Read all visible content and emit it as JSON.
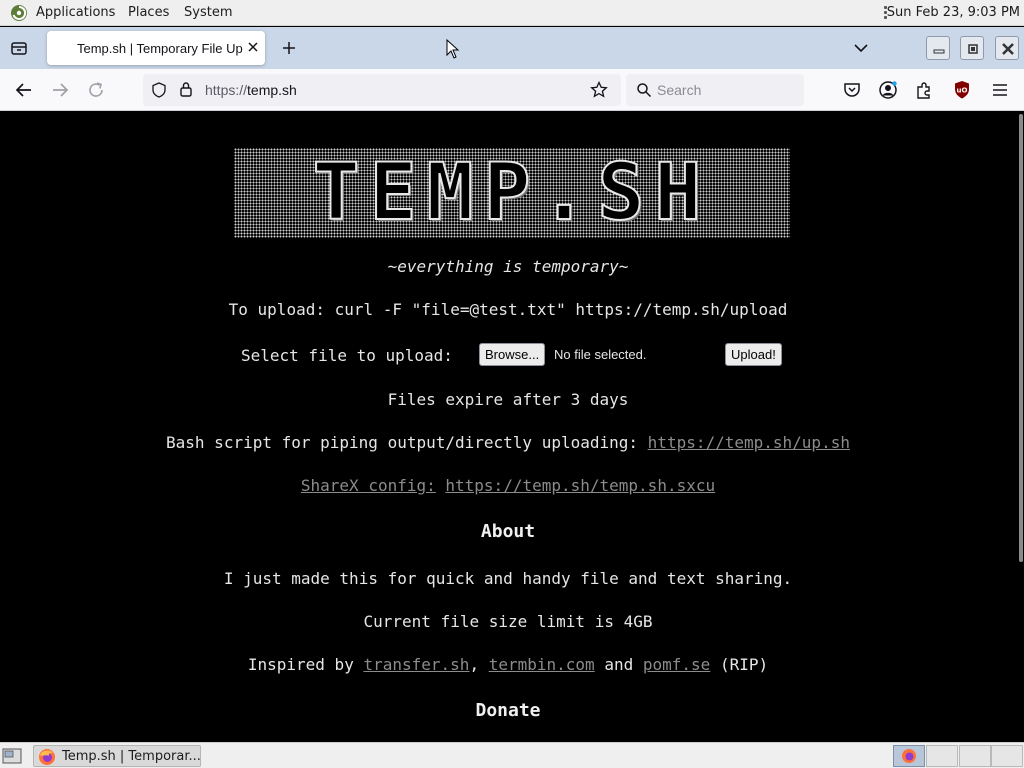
{
  "top_panel": {
    "menus": [
      "Applications",
      "Places",
      "System"
    ],
    "clock": "Sun Feb 23,  9:03 PM"
  },
  "browser": {
    "tab": {
      "title": "Temp.sh | Temporary File Upload"
    },
    "url": "https://temp.sh",
    "url_prefix": "https://",
    "url_host": "temp.sh",
    "search_placeholder": "Search"
  },
  "page": {
    "logo_text": "TEMP.SH",
    "tagline": "~everything is temporary~",
    "upload_cmd": "To upload: curl -F \"file=@test.txt\" https://temp.sh/upload",
    "select_label": "Select file to upload:",
    "browse_label": "Browse...",
    "no_file": "No file selected.",
    "upload_label": "Upload!",
    "expire": "Files expire after 3 days",
    "bash_label": "Bash script for piping output/directly uploading:",
    "bash_link": "https://temp.sh/up.sh",
    "sharex_label": "ShareX config:",
    "sharex_link": "https://temp.sh/temp.sh.sxcu",
    "about_heading": "About",
    "about_text": "I just made this for quick and handy file and text sharing.",
    "size_limit": "Current file size limit is 4GB",
    "inspired_prefix": "Inspired by",
    "inspired_links": [
      "transfer.sh",
      "termbin.com",
      "pomf.se"
    ],
    "comma": ",",
    "and": "and",
    "rip": "(RIP)",
    "donate_heading": "Donate"
  },
  "taskbar": {
    "task_label": "Temp.sh | Temporar..."
  },
  "colors": {
    "page_bg": "#000000",
    "page_text": "#e6e6e6",
    "link": "#8c8c8c",
    "tabstrip": "#c9d7e9"
  }
}
